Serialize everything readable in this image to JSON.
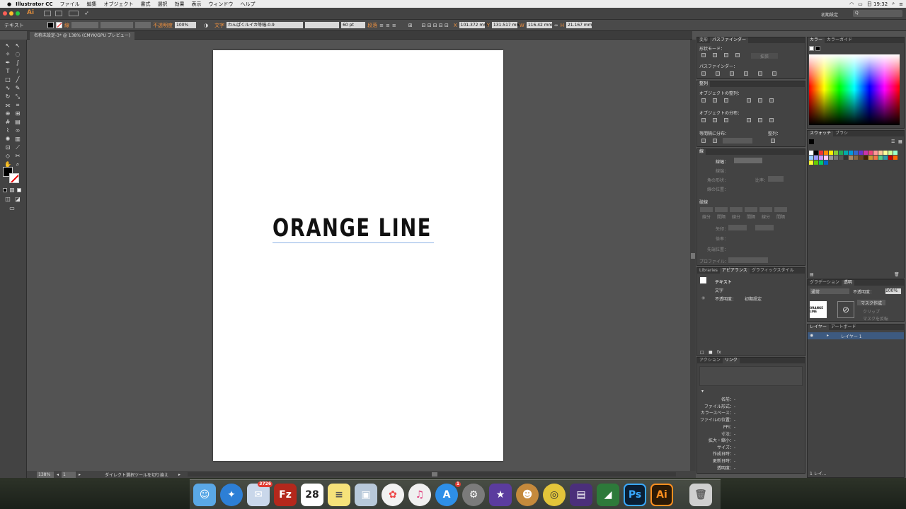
{
  "menubar": {
    "app": "Illustrator CC",
    "items": [
      "ファイル",
      "編集",
      "オブジェクト",
      "書式",
      "選択",
      "効果",
      "表示",
      "ウィンドウ",
      "ヘルプ"
    ],
    "clock": "日 19:32"
  },
  "appbar": {
    "workspace": "初期設定",
    "search_placeholder": "Q"
  },
  "control": {
    "selection_type": "テキスト",
    "stroke_label": "線",
    "opacity_label": "不透明度",
    "opacity": "100%",
    "char_label": "文字",
    "font": "わんぱくルイカ等幅-0.9",
    "size": "60 pt",
    "para_label": "段落",
    "x_label": "X",
    "x": "101.372 mm",
    "y_label": "Y",
    "y": "131.517 mm",
    "w_label": "W",
    "w": "116.42 mm",
    "h_label": "H",
    "h": "21.167 mm"
  },
  "document": {
    "tab_title": "名称未設定-3* @ 138% (CMYK/GPU プレビュー)",
    "headline": "ORANGE LINE"
  },
  "statusbar": {
    "zoom": "138%",
    "page": "1",
    "tool": "ダイレクト選択ツールを切り換え"
  },
  "pathfinder_panel": {
    "tabs": [
      "変形",
      "パスファインダー"
    ],
    "shape_modes": "形状モード：",
    "expand": "拡張",
    "pathfinders": "パスファインダー："
  },
  "align_panel": {
    "tab": "整列",
    "align_objects": "オブジェクトの整列：",
    "distribute_objects": "オブジェクトの分布：",
    "distribute_spacing": "等間隔に分布：",
    "align_to": "整列："
  },
  "stroke_panel": {
    "tab": "線",
    "weight": "線幅：",
    "cap": "線端：",
    "corner": "角の形状：",
    "limit": "比率：",
    "align_stroke": "線の位置：",
    "dashed": "破線",
    "dash_labels": [
      "線分",
      "間隔",
      "線分",
      "間隔",
      "線分",
      "間隔"
    ],
    "arrows": "矢印：",
    "scale": "倍率：",
    "align": "先端位置：",
    "profile": "プロファイル："
  },
  "appearance_panel": {
    "tabs": [
      "Libraries",
      "アピアランス",
      "グラフィックスタイル"
    ],
    "title": "テキスト",
    "character": "文字",
    "opacity_label": "不透明度：",
    "opacity_value": "初期設定"
  },
  "links_panel": {
    "tabs": [
      "アクション",
      "リンク"
    ],
    "fields": [
      "名前：-",
      "ファイル形式：-",
      "カラースペース：-",
      "ファイルの位置：-",
      "PPI：-",
      "寸法：-",
      "拡大・縮小：-",
      "サイズ：-",
      "作成日時：-",
      "更新日時：-",
      "透明度：-"
    ]
  },
  "color_panel": {
    "tabs": [
      "カラー",
      "カラーガイド"
    ]
  },
  "swatches_panel": {
    "tabs": [
      "スウォッチ",
      "ブラシ"
    ]
  },
  "transparency_panel": {
    "tabs": [
      "グラデーション",
      "透明"
    ],
    "mode": "通常",
    "opacity_label": "不透明度：",
    "opacity": "100%",
    "make_mask": "マスク作成",
    "clip": "クリップ",
    "invert": "マスクを反転",
    "thumb_text": "ORANGE LINE"
  },
  "layers_panel": {
    "tabs": [
      "レイヤー",
      "アートボード"
    ],
    "layer_name": "レイヤー 1",
    "footer": "1 レイ..."
  },
  "dock": {
    "items": [
      "finder",
      "safari",
      "mail",
      "filezilla",
      "calendar",
      "notes",
      "preview",
      "photos",
      "itunes",
      "appstore",
      "sysprefs",
      "imovie",
      "monkey",
      "dvd",
      "trash-photo",
      "onenote",
      "photoshop",
      "illustrator",
      "trash"
    ],
    "mail_badge": "3726",
    "appstore_badge": "1",
    "calendar_day": "28",
    "fz_label": "Fz",
    "ps_label": "Ps",
    "ai_label": "Ai"
  }
}
